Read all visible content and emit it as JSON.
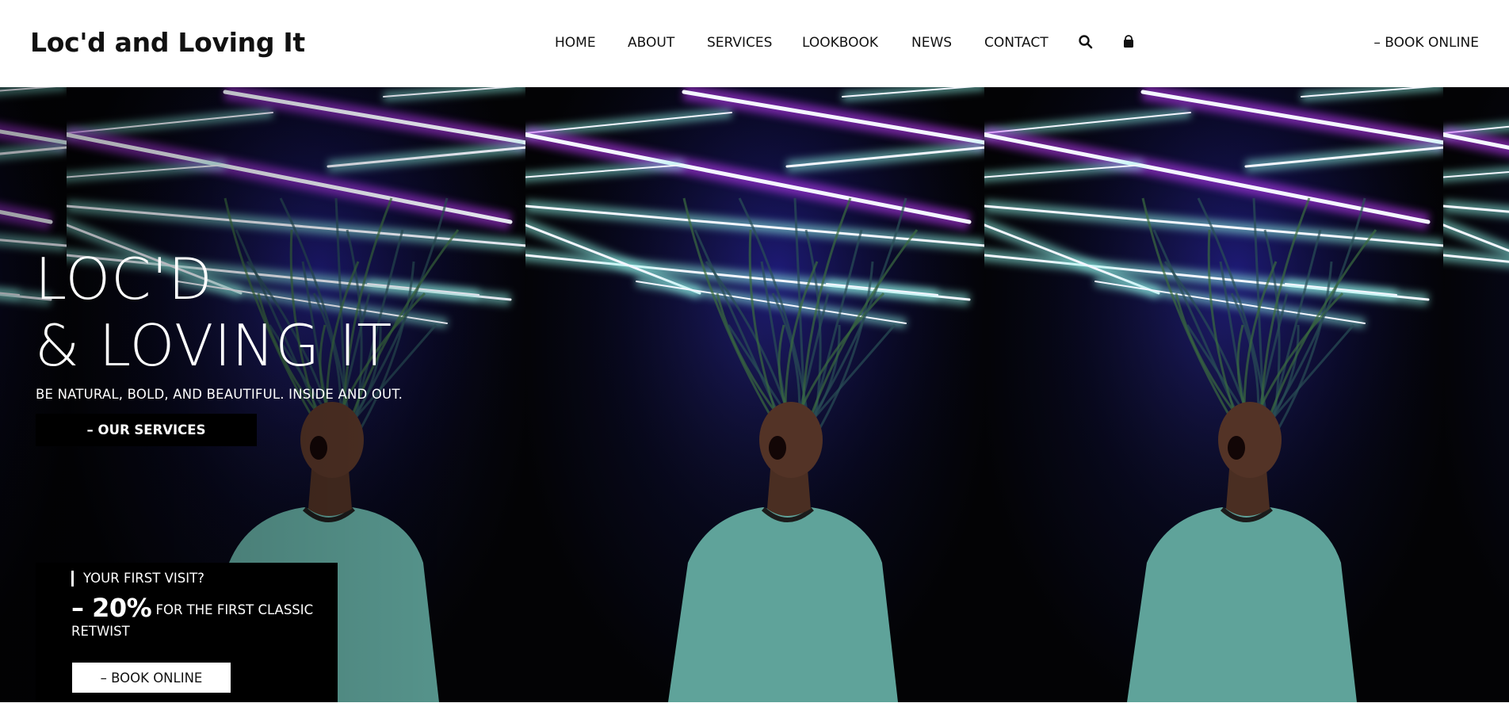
{
  "header": {
    "logo": "Loc'd and Loving It",
    "nav": [
      {
        "label": "HOME"
      },
      {
        "label": "ABOUT"
      },
      {
        "label": "SERVICES"
      },
      {
        "label": "LOOKBOOK"
      },
      {
        "label": "NEWS"
      },
      {
        "label": "CONTACT"
      }
    ],
    "icons": [
      "search-icon",
      "shopping-bag-icon"
    ],
    "book_online": "– BOOK ONLINE"
  },
  "hero": {
    "title_line1": "LOC'D",
    "title_line2": "& LOVING IT",
    "subtitle": "BE NATURAL, BOLD, AND BEAUTIFUL. INSIDE AND OUT.",
    "services_button": "– OUR SERVICES",
    "image_description_colors": {
      "neon_purple": "#c23bff",
      "neon_blue": "#3a2dff",
      "neon_cyan": "#8ff5e8",
      "shirt": "#5fa39a"
    }
  },
  "promo": {
    "heading": "YOUR FIRST VISIT?",
    "discount": "– 20%",
    "offer_text": "FOR THE FIRST CLASSIC RETWIST",
    "book_button": "– BOOK ONLINE"
  }
}
